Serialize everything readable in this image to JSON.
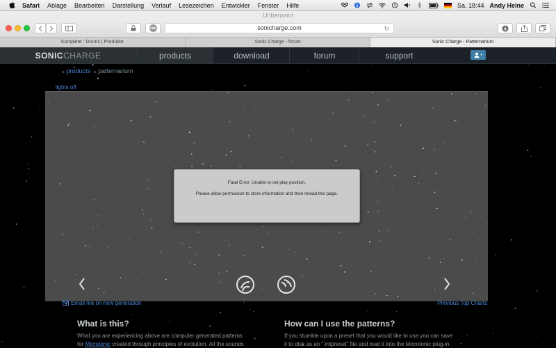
{
  "menubar": {
    "items": [
      "Safari",
      "Ablage",
      "Bearbeiten",
      "Darstellung",
      "Verlauf",
      "Lesezeichen",
      "Entwickler",
      "Fenster",
      "Hilfe"
    ],
    "clock": "Sa. 18:44",
    "user": "Andy Heine"
  },
  "window": {
    "title": "Unbenannt"
  },
  "toolbar": {
    "url": "sonicharge.com",
    "abp_label": "ABP"
  },
  "tabs": [
    {
      "label": "Komplete : Drums | Produkte",
      "active": false
    },
    {
      "label": "Sonic Charge - forum",
      "active": false
    },
    {
      "label": "Sonic Charge - Patternarium",
      "active": true
    }
  ],
  "site": {
    "logo_part1": "SONIC",
    "logo_part2": "CHARGE",
    "nav": [
      "products",
      "download",
      "forum",
      "support"
    ]
  },
  "breadcrumb": {
    "item1": "products",
    "item2": "patternarium"
  },
  "lights_off": "lights off",
  "dialog": {
    "line1": "Fatal Error: Unable to set play position.",
    "line2": "Please allow permission to store information and then reload this page."
  },
  "links": {
    "email": "Email me on new generation",
    "previous": "Previous Top Charts"
  },
  "what": {
    "heading": "What is this?",
    "line1": "What you are experiencing above are computer generated patterns",
    "line2_pre": "for ",
    "line2_link": "Microtonic",
    "line2_post": " created through principles of evolution. All the sounds"
  },
  "how": {
    "heading": "How can I use the patterns?",
    "line1": "If you stumble upon a preset that you would like to use you can save",
    "line2": "it to disk as an \".mtpreset\" file and load it into the Microtonic plug-in."
  }
}
